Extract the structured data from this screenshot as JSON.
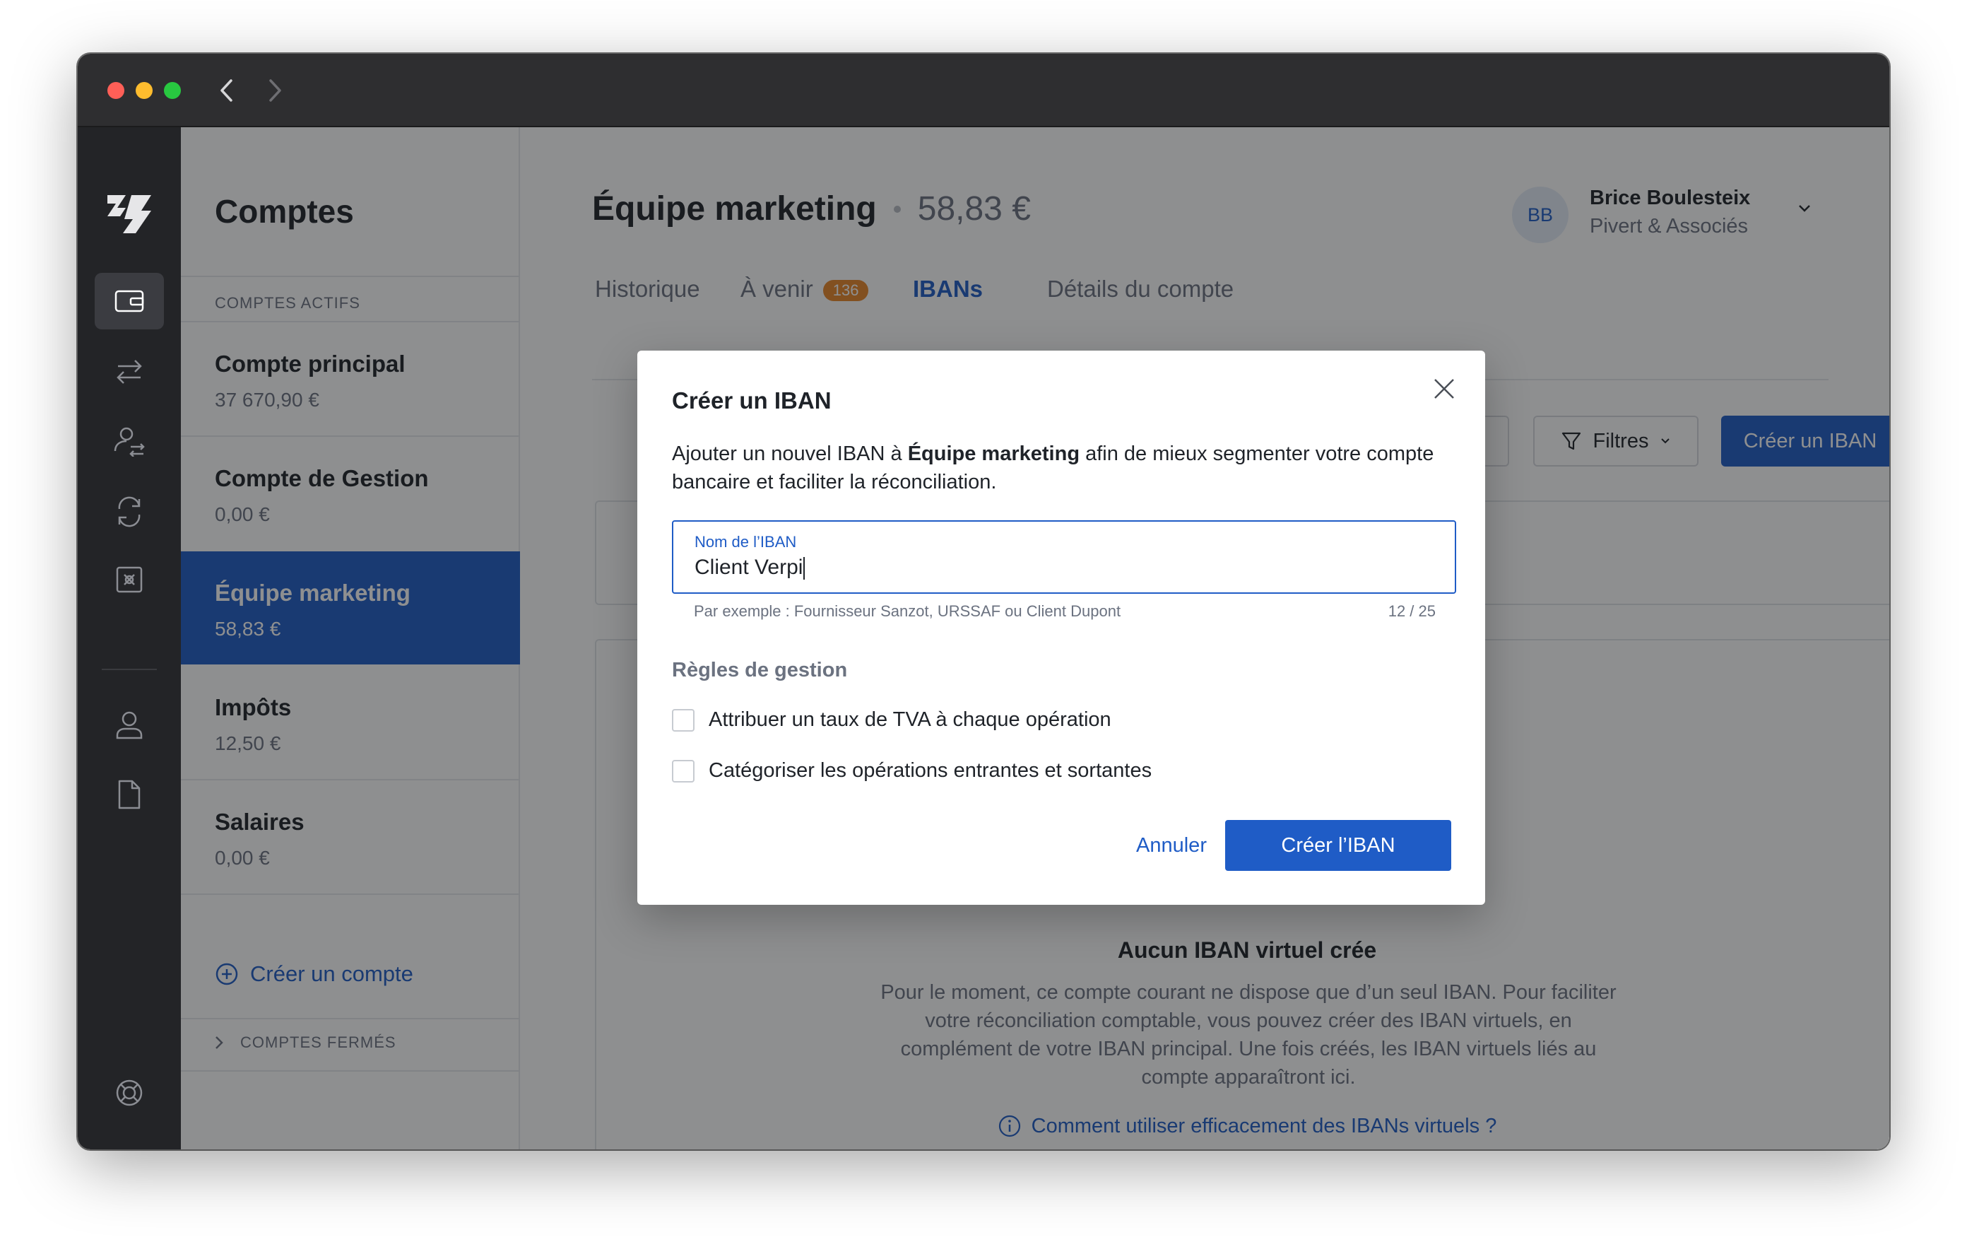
{
  "sidebar": {
    "title": "Comptes",
    "active_section_label": "COMPTES ACTIFS",
    "accounts": [
      {
        "name": "Compte principal",
        "balance": "37 670,90 €"
      },
      {
        "name": "Compte de Gestion",
        "balance": "0,00 €"
      },
      {
        "name": "Équipe marketing",
        "balance": "58,83 €"
      },
      {
        "name": "Impôts",
        "balance": "12,50 €"
      },
      {
        "name": "Salaires",
        "balance": "0,00 €"
      }
    ],
    "selected_index": 2,
    "create_account_label": "Créer un compte",
    "closed_section_label": "COMPTES FERMÉS"
  },
  "header": {
    "account_name": "Équipe marketing",
    "account_balance": "58,83 €"
  },
  "user": {
    "initials": "BB",
    "name": "Brice Boulesteix",
    "company": "Pivert & Associés"
  },
  "tabs": [
    {
      "label": "Historique"
    },
    {
      "label": "À venir",
      "badge": "136"
    },
    {
      "label": "IBANs"
    },
    {
      "label": "Détails du compte"
    }
  ],
  "active_tab": "IBANs",
  "toolbar": {
    "filters_label": "Filtres",
    "create_iban_label": "Créer un IBAN"
  },
  "empty_state": {
    "title": "Aucun IBAN virtuel crée",
    "text": "Pour le moment, ce compte courant ne dispose que d’un seul IBAN. Pour faciliter votre réconciliation comptable, vous pouvez créer des IBAN virtuels, en complément de votre IBAN principal. Une fois créés, les IBAN virtuels liés au compte apparaîtront ici.",
    "link": "Comment utiliser efficacement des IBANs virtuels ?"
  },
  "modal": {
    "title": "Créer un IBAN",
    "desc_prefix": "Ajouter un nouvel IBAN à ",
    "desc_account": "Équipe marketing",
    "desc_suffix": " afin de mieux segmenter votre compte bancaire et faciliter la réconciliation.",
    "field_label": "Nom de l’IBAN",
    "field_value": "Client Verpi",
    "field_hint": "Par exemple : Fournisseur Sanzot, URSSAF ou Client Dupont",
    "field_count": "12 / 25",
    "rules_title": "Règles de gestion",
    "rules": [
      {
        "label": "Attribuer un taux de TVA à chaque opération",
        "checked": false
      },
      {
        "label": "Catégoriser les opérations entrantes et sortantes",
        "checked": false
      }
    ],
    "cancel_label": "Annuler",
    "submit_label": "Créer l’IBAN"
  },
  "colors": {
    "accent": "#1f5cc6",
    "badge": "#e8862a",
    "rail": "#232427"
  }
}
